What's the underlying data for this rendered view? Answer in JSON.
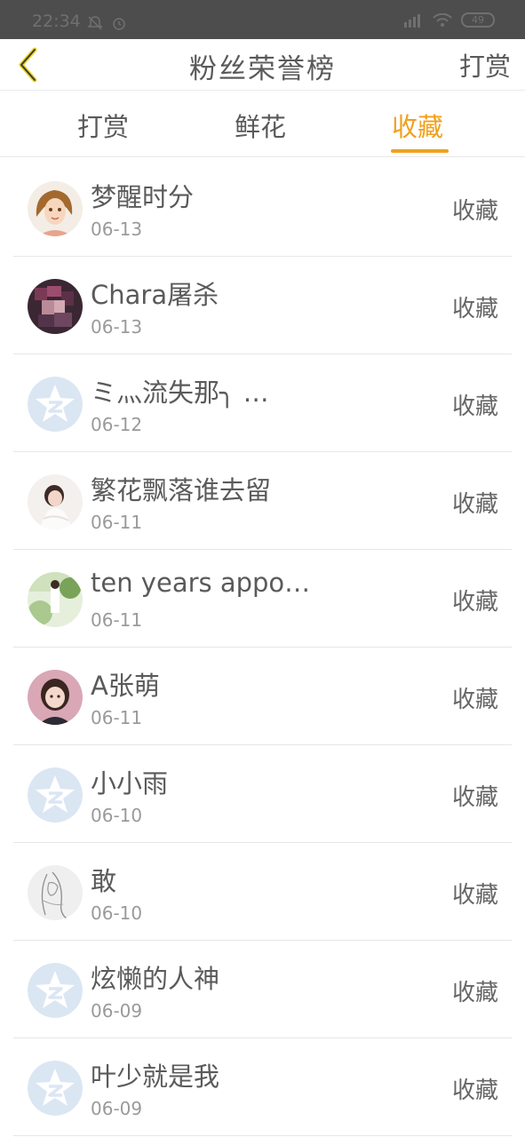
{
  "status": {
    "time": "22:34",
    "battery": "49"
  },
  "header": {
    "title": "粉丝荣誉榜",
    "action": "打赏"
  },
  "tabs": [
    {
      "label": "打赏",
      "active": false
    },
    {
      "label": "鲜花",
      "active": false
    },
    {
      "label": "收藏",
      "active": true
    }
  ],
  "colors": {
    "accent": "#f0a11c",
    "default_avatar": "#dbe6f3"
  },
  "items": [
    {
      "name": "梦醒时分",
      "date": "06-13",
      "action": "收藏",
      "avatar": "photo-girl-cartoon"
    },
    {
      "name": "Chara屠杀",
      "date": "06-13",
      "action": "收藏",
      "avatar": "photo-anime"
    },
    {
      "name": "ミ灬流失那╮ …",
      "date": "06-12",
      "action": "收藏",
      "avatar": "default-avatar"
    },
    {
      "name": "繁花飘落谁去留",
      "date": "06-11",
      "action": "收藏",
      "avatar": "photo-woman"
    },
    {
      "name": "ten years appo…",
      "date": "06-11",
      "action": "收藏",
      "avatar": "photo-outdoor"
    },
    {
      "name": "A张萌",
      "date": "06-11",
      "action": "收藏",
      "avatar": "photo-girl"
    },
    {
      "name": "小小雨",
      "date": "06-10",
      "action": "收藏",
      "avatar": "default-avatar"
    },
    {
      "name": "敢",
      "date": "06-10",
      "action": "收藏",
      "avatar": "photo-sketch"
    },
    {
      "name": "炫懒的人神",
      "date": "06-09",
      "action": "收藏",
      "avatar": "default-avatar"
    },
    {
      "name": "叶少就是我",
      "date": "06-09",
      "action": "收藏",
      "avatar": "default-avatar"
    }
  ]
}
